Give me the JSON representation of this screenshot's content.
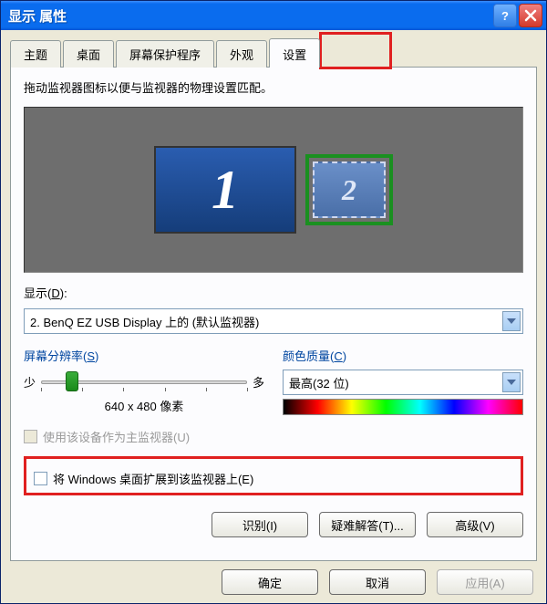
{
  "window": {
    "title": "显示 属性"
  },
  "tabs": [
    "主题",
    "桌面",
    "屏幕保护程序",
    "外观",
    "设置"
  ],
  "active_tab_index": 4,
  "instruction": "拖动监视器图标以便与监视器的物理设置匹配。",
  "monitors": {
    "primary": "1",
    "secondary": "2"
  },
  "display_field": {
    "label": "显示(D):",
    "label_underline": "D",
    "value": "2. BenQ EZ USB Display 上的 (默认监视器)"
  },
  "resolution": {
    "title": "屏幕分辨率(S)",
    "title_underline": "S",
    "less": "少",
    "more": "多",
    "value_text": "640 x 480 像素"
  },
  "color_quality": {
    "title": "颜色质量(C)",
    "title_underline": "C",
    "value": "最高(32 位)"
  },
  "checkboxes": {
    "use_as_primary": "使用该设备作为主监视器(U)",
    "extend_desktop": "将 Windows 桌面扩展到该监视器上(E)"
  },
  "buttons": {
    "identify": "识别(I)",
    "troubleshoot": "疑难解答(T)...",
    "advanced": "高级(V)",
    "ok": "确定",
    "cancel": "取消",
    "apply": "应用(A)"
  }
}
